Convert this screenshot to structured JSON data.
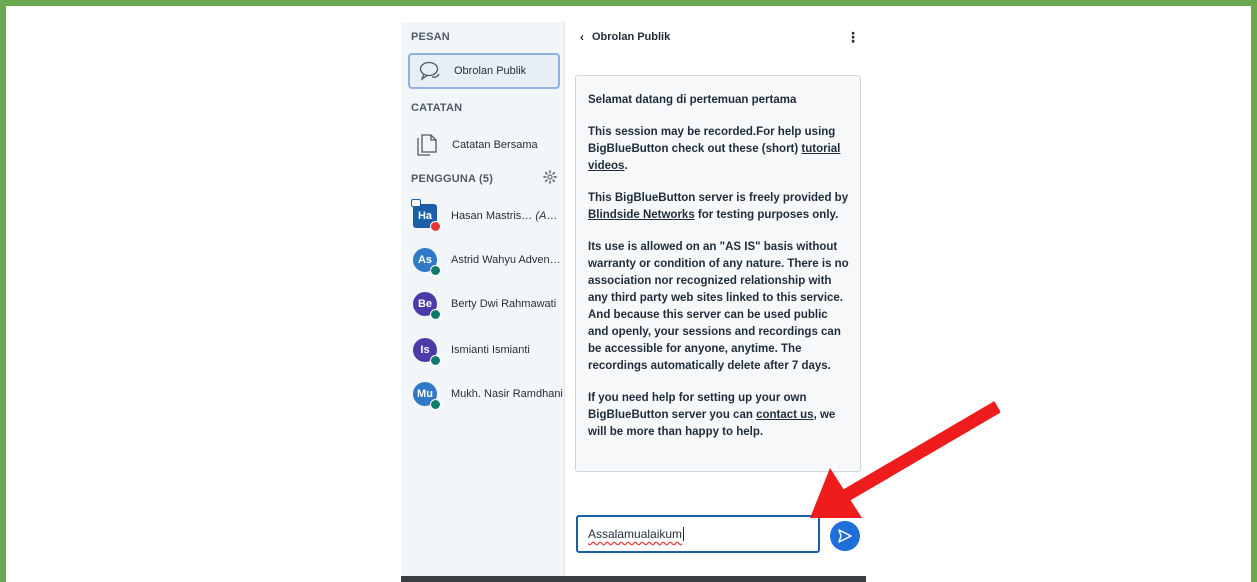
{
  "sidebar": {
    "messages_title": "PESAN",
    "public_chat_label": "Obrolan Publik",
    "notes_title": "CATATAN",
    "shared_notes_label": "Catatan Bersama",
    "users_title": "PENGGUNA (5)",
    "users": [
      {
        "initials": "Ha",
        "name": "Hasan Mastris…",
        "you": "(Anda)",
        "color": "#1b5fa8",
        "status": "mic"
      },
      {
        "initials": "As",
        "name": "Astrid Wahyu Advent…",
        "you": "",
        "color": "#2f79c6",
        "status": "listen"
      },
      {
        "initials": "Be",
        "name": "Berty Dwi Rahmawati",
        "you": "",
        "color": "#4b3aa8",
        "status": "listen"
      },
      {
        "initials": "Is",
        "name": "Ismianti Ismianti",
        "you": "",
        "color": "#4b3aa8",
        "status": "listen"
      },
      {
        "initials": "Mu",
        "name": "Mukh. Nasir Ramdhani",
        "you": "",
        "color": "#2f79c6",
        "status": "listen"
      }
    ]
  },
  "chat": {
    "header_title": "Obrolan Publik",
    "welcome": {
      "p1": "Selamat datang di pertemuan pertama",
      "p2_a": "This session may be recorded.For help using BigBlueButton check out these (short) ",
      "p2_link": "tutorial videos",
      "p2_b": ".",
      "p3_a": "This BigBlueButton server is freely provided by ",
      "p3_link": "Blindside Networks",
      "p3_b": " for testing purposes only.",
      "p4": "Its use is allowed on an \"AS IS\" basis without warranty or condition of any nature. There is no association nor recognized relationship with any third party web sites linked to this service. And because this server can be used public and openly, your sessions and recordings can be accessible for anyone, anytime. The recordings automatically delete after 7 days.",
      "p5_a": "If you need help for setting up your own BigBlueButton server you can ",
      "p5_link": "contact us",
      "p5_b": ", we will be more than happy to help."
    },
    "input_value": "Assalamualaikum"
  },
  "colors": {
    "frame_border": "#6aa84f",
    "accent_blue": "#1e6fd9",
    "annotation_arrow": "#ee1c1c"
  }
}
